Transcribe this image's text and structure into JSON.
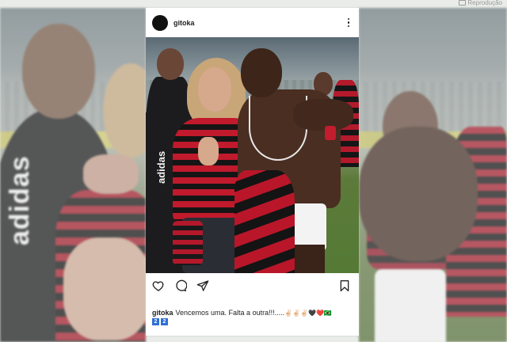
{
  "credit": {
    "label": "Reprodução"
  },
  "post": {
    "username": "gitoka",
    "photo_alt": "Foto",
    "photo_jersey_text": "adidas",
    "caption": {
      "username": "gitoka",
      "text": "Vencemos uma. Falta a outra!!!.....",
      "emojis": "✌🏻✌🏻✌🏻🖤❤️🇧🇷",
      "badges": [
        "2",
        "2"
      ]
    }
  },
  "background": {
    "jersey_text": "adidas"
  },
  "colors": {
    "badge": "#2f6fd6",
    "flamengo_red": "#c01a2c",
    "flamengo_black": "#151515"
  }
}
